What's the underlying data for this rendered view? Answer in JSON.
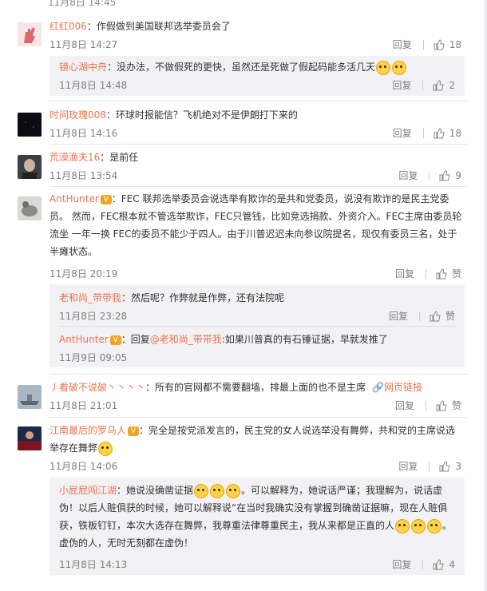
{
  "top_partial": "11月8日 14:45",
  "labels": {
    "reply": "回复",
    "like": "赞"
  },
  "comments": [
    {
      "user": "红红006",
      "content": "：作假做到美国联邦选举委员会了",
      "time": "11月8日 14:27",
      "likes": "18",
      "reply": {
        "user": "镜心湖中舟",
        "content": "：没办法，不做假死的更快，虽然还是死做了假起码能多活几天",
        "time": "11月8日 14:48",
        "likes": "2"
      }
    },
    {
      "user": "时间玫瑰008",
      "content": "：环球时报能信？飞机绝对不是伊朗打下来的",
      "time": "11月8日 14:16",
      "likes": "18"
    },
    {
      "user": "荒漠渔夫16",
      "content": "：是前任",
      "time": "11月8日 13:54",
      "likes": "9"
    },
    {
      "user": "AntHunter",
      "content_l1": "：FEC 联邦选举委员会说选举有欺诈的是共和党委员，说没有欺诈的是民主党委",
      "content_l2": "员。 然而，FEC根本就不管选举欺诈，FEC只管钱，比如竞选捐款、外资介入。FEC主席由委员轮",
      "content_l3": "流坐 一年一换 FEC的委员不能少于四人。由于川普迟迟未向参议院提名，现仅有委员三名，处于",
      "content_l4": "半瘫状态。",
      "time": "11月8日 20:19",
      "likes": "赞",
      "replies": [
        {
          "user": "老和尚_带带我",
          "content": "：然后呢？作弊就是作弊，还有法院呢",
          "time": "11月8日 23:28",
          "likes": "赞"
        },
        {
          "user": "AntHunter",
          "content_pre": "：回复",
          "mention": "@老和尚_带带我",
          "content_post": ":如果川普真的有石锤证据，早就发推了",
          "time": "11月9日 09:05"
        }
      ]
    },
    {
      "user": "丿看破不说破丶丶丶丶",
      "content": "：所有的官网都不需要翻墙，排最上面的也不是主席",
      "weblink": "网页链接",
      "time": "11月8日 21:01",
      "likes": "赞"
    },
    {
      "user": "江南最后的罗马人",
      "content_l1": "：完全是按党派发言的，民主党的女人说选举没有舞弊，共和党的主席说选",
      "content_l2": "举存在舞弊",
      "time": "11月8日 14:06",
      "likes": "3",
      "reply": {
        "user": "小屁屁闯江湖",
        "content_l1": "：她说没确凿证据",
        "content_l1b": "。可以解释为，她说话严谨；我理解为，说话虚",
        "content_l2": "伪！以后人赃俱获的时候，她可以解释说“在当时我确实没有掌握到确凿证据嘛，现在人赃俱",
        "content_l3": "获，铁板钉钉，本次大选存在舞弊，我尊重法律尊重民主，我从来都是正直的人",
        "content_l4": "虚伪的人，无时无刻都在虚伪！",
        "time": "11月8日 14:13",
        "likes": "4"
      }
    }
  ]
}
